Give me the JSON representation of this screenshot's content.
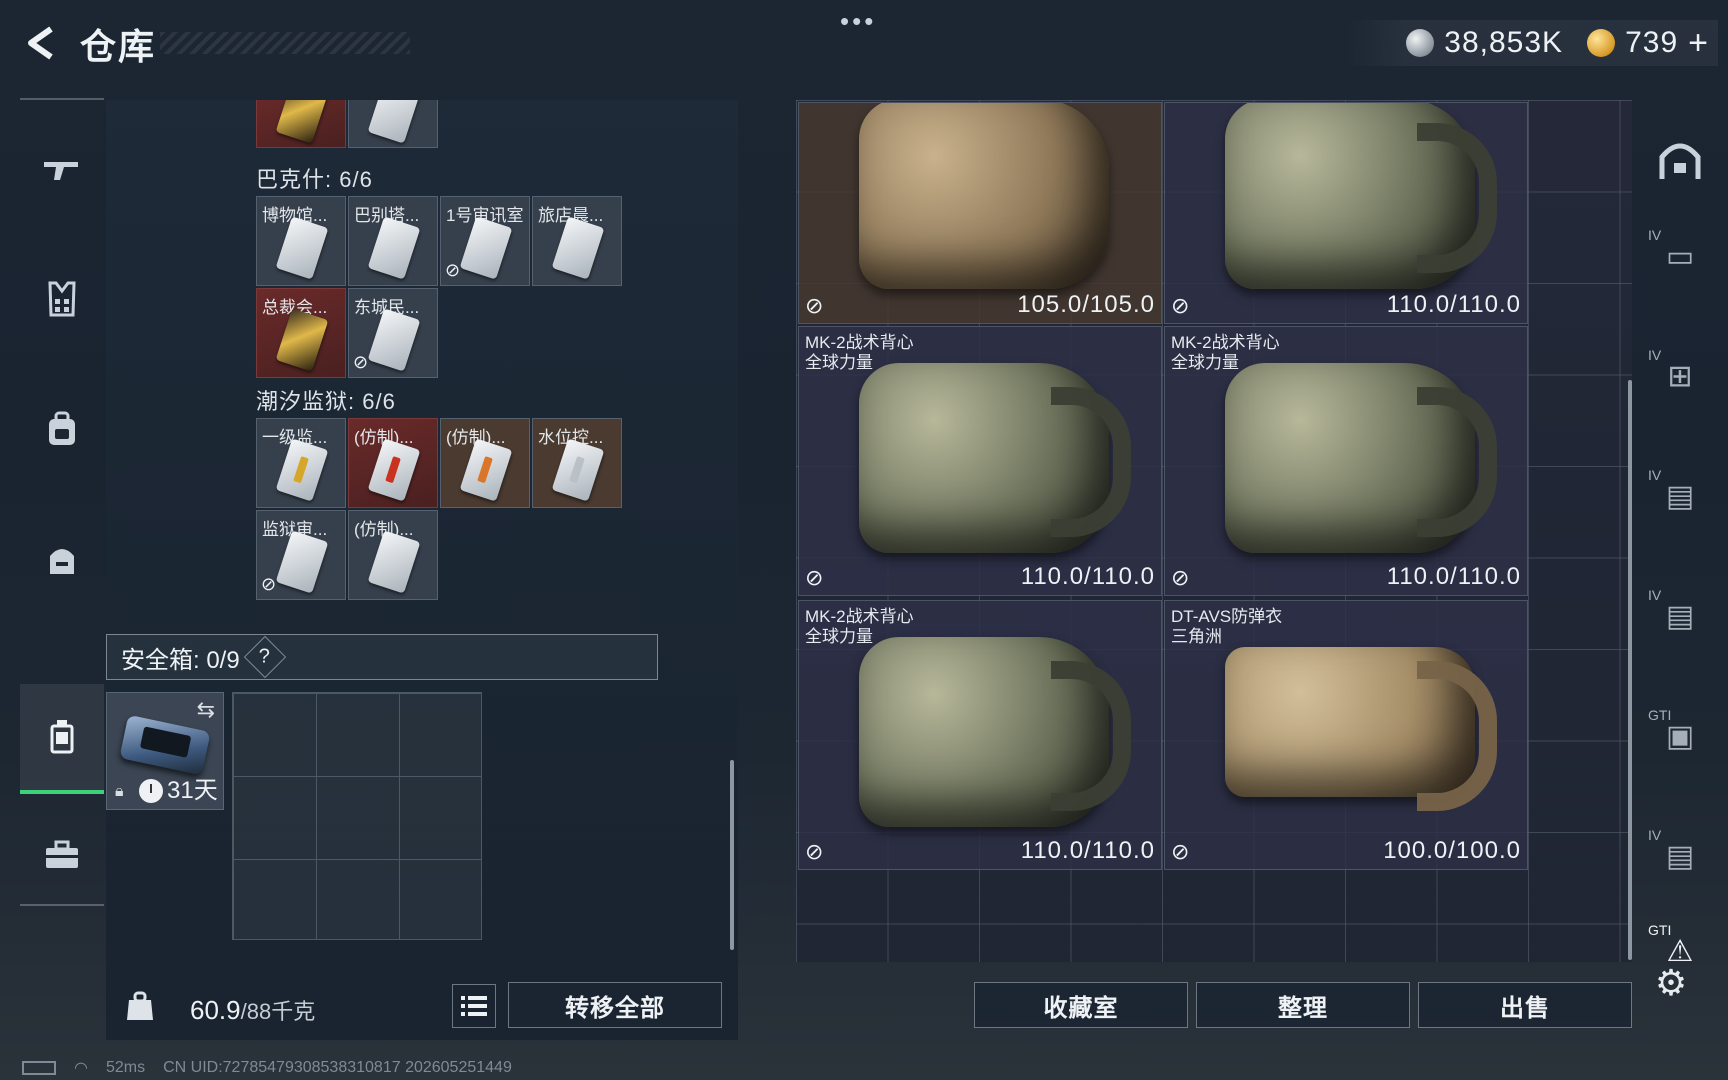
{
  "header": {
    "title": "仓库",
    "currency_silver": "38,853K",
    "currency_gold": "739",
    "plus_label": "+"
  },
  "left_nav": {
    "items": [
      {
        "icon": "rifle-icon"
      },
      {
        "icon": "armor-icon"
      },
      {
        "icon": "backpack-icon"
      },
      {
        "icon": "helmet-bag-icon"
      },
      {
        "icon": "container-icon",
        "active": true
      },
      {
        "icon": "briefcase-icon"
      }
    ]
  },
  "groups": [
    {
      "label": "巴克什: 6/6",
      "items": [
        "博物馆...",
        "巴别塔...",
        "1号审讯室",
        "旅店晨...",
        "总裁会...",
        "东城民..."
      ]
    },
    {
      "label": "潮汐监狱: 6/6",
      "items": [
        "一级监...",
        "(仿制)...",
        "(仿制)...",
        "水位控...",
        "监狱审...",
        "(仿制)..."
      ]
    }
  ],
  "safe_box": {
    "label": "安全箱: 0/9",
    "help": "?",
    "days": "31天"
  },
  "bottom_left": {
    "weight": "60.9",
    "weight_max": "/88千克",
    "transfer_all": "转移全部"
  },
  "vests": [
    {
      "name": "",
      "durability": "105.0/105.0"
    },
    {
      "name": "",
      "durability": "110.0/110.0"
    },
    {
      "name": "MK-2战术背心\n全球力量",
      "durability": "110.0/110.0"
    },
    {
      "name": "MK-2战术背心\n全球力量",
      "durability": "110.0/110.0"
    },
    {
      "name": "MK-2战术背心\n全球力量",
      "durability": "110.0/110.0"
    },
    {
      "name": "DT-AVS防弹衣\n三角洲",
      "durability": "100.0/100.0"
    }
  ],
  "bottom_right": {
    "collection": "收藏室",
    "sort": "整理",
    "sell": "出售"
  },
  "right_nav": {
    "items": [
      {
        "tag": "",
        "icon": "home-icon"
      },
      {
        "tag": "IV",
        "icon": "storage-search-icon"
      },
      {
        "tag": "IV",
        "icon": "storage-add-icon"
      },
      {
        "tag": "IV",
        "icon": "storage-folder-icon"
      },
      {
        "tag": "IV",
        "icon": "storage-folder-icon"
      },
      {
        "tag": "GTI",
        "icon": "storage-gear-icon"
      },
      {
        "tag": "IV",
        "icon": "storage-folder-icon"
      },
      {
        "tag": "GTI",
        "icon": "storage-warning-icon"
      }
    ]
  },
  "status": {
    "ping": "52ms",
    "uid": "CN UID:7278547930853831081​7  202605251449"
  },
  "colors": {
    "accent_green": "#3fd07a",
    "slot_red": "#6a2a2a",
    "vest_brown": "#46382e"
  }
}
